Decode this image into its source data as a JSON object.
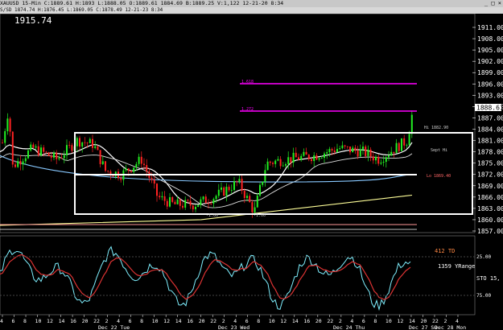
{
  "window": {
    "title": "XAUUSD 15-Min C:1889.61 H:1893 L:1888.05 O:1889.61 1884.69 B:1889.25 V:1,122 12-21-20 8:34",
    "controls": "_ □ ×",
    "info_line": "S/SD 1874.74 H:1876.45 L:1869.05 C:1878.49 12-21-23 8:34"
  },
  "price_panel": {
    "last_price_display": "1915.74",
    "current_price_tag": "1888.61",
    "y_ticks": [
      "1911.00",
      "1908.00",
      "1905.00",
      "1902.00",
      "1899.00",
      "1896.00",
      "1893.00",
      "1890.00",
      "1887.00",
      "1884.00",
      "1881.00",
      "1878.00",
      "1875.00",
      "1872.00",
      "1869.00",
      "1866.00",
      "1863.00",
      "1860.00",
      "1857.00"
    ],
    "levels": [
      {
        "label": "1.618",
        "price": 1895.0,
        "color": "#ff00ff"
      },
      {
        "label": "1.272",
        "price": 1888.0,
        "color": "#ff00ff"
      }
    ],
    "annotations": [
      {
        "label": "Hi 1882.90"
      },
      {
        "label": "Sept Hi"
      },
      {
        "label": "Lo 1869.40"
      },
      {
        "label": "-1.00"
      },
      {
        "label": "-1.00"
      }
    ]
  },
  "indicator_panel": {
    "name": "STO",
    "value_label": "STO 15,",
    "td_label": "412 TD",
    "yrange_label": "1359 YRange",
    "tick_25": "25.00",
    "tick_75": "75.00"
  },
  "x_axis": {
    "hour_ticks": [
      "4",
      "6",
      "8",
      "10",
      "12",
      "14",
      "16",
      "20",
      "22",
      "2",
      "4",
      "6",
      "8",
      "10",
      "12",
      "14",
      "16",
      "20",
      "22",
      "2",
      "4",
      "6",
      "8",
      "10",
      "12",
      "14",
      "16",
      "20",
      "22",
      "2",
      "4",
      "6",
      "8",
      "10",
      "12",
      "14",
      "20",
      "22",
      "2",
      "4"
    ],
    "date_labels": [
      "Dec 22 Tue",
      "Dec 23 Wed",
      "Dec 24 Thu",
      "Dec 27 Su",
      "Dec 28 Mon"
    ]
  },
  "colors": {
    "candle_up": "#22ee22",
    "candle_down": "#ff2222",
    "ma_white": "#ffffff",
    "ma_blue": "#88c8ff",
    "ma_yellow": "#ffff99",
    "sto_fast": "#7ff0ff",
    "sto_slow": "#dd3333",
    "fib": "#ff00ff"
  }
}
